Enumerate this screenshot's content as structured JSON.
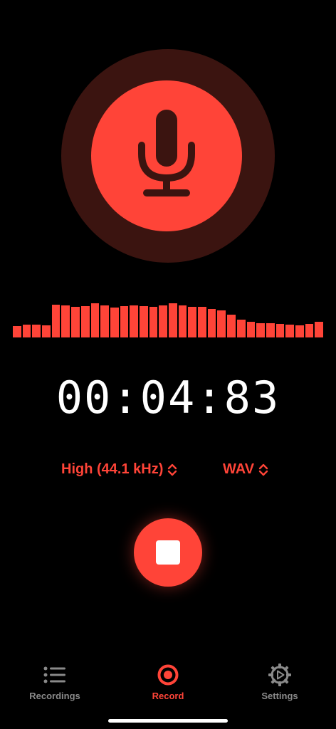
{
  "colors": {
    "background": "#000000",
    "accent": "#ff4438",
    "mic_ring": "#3b1410",
    "inactive_tab": "#8a8a8a",
    "stop_square": "#ffffff"
  },
  "mic": {
    "icon": "microphone-icon"
  },
  "waveform": {
    "levels": [
      0.3,
      0.33,
      0.33,
      0.32,
      0.86,
      0.84,
      0.79,
      0.81,
      0.89,
      0.84,
      0.78,
      0.82,
      0.83,
      0.82,
      0.79,
      0.84,
      0.88,
      0.83,
      0.8,
      0.79,
      0.75,
      0.7,
      0.6,
      0.46,
      0.41,
      0.37,
      0.37,
      0.35,
      0.33,
      0.31,
      0.35,
      0.41
    ]
  },
  "timer": {
    "value": "00:04:83"
  },
  "selectors": {
    "quality": "High (44.1 kHz)",
    "format": "WAV",
    "chevron_icon": "chevron-up-down-icon"
  },
  "controls": {
    "stop_icon": "stop-icon"
  },
  "tabs": [
    {
      "label": "Recordings",
      "icon": "list-icon",
      "active": false
    },
    {
      "label": "Record",
      "icon": "record-icon",
      "active": true
    },
    {
      "label": "Settings",
      "icon": "gear-icon",
      "active": false
    }
  ]
}
